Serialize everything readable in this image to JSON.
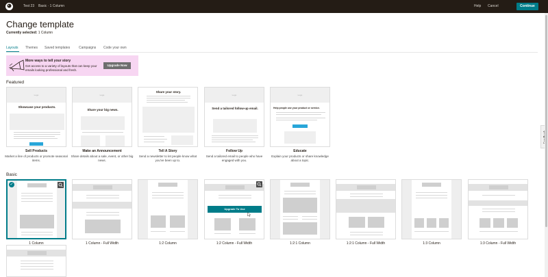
{
  "topbar": {
    "breadcrumb_campaign": "Test 23",
    "breadcrumb_section": "Basic · 1 Column",
    "help_label": "Help",
    "cancel_label": "Cancel",
    "continue_label": "Continue"
  },
  "page": {
    "title": "Change template",
    "current_label": "Currently selected:",
    "current_value": "1 Column"
  },
  "tabs": [
    "Layouts",
    "Themes",
    "Saved templates",
    "Campaigns",
    "Code your own"
  ],
  "promo": {
    "title": "More ways to tell your story",
    "body": "Get access to a variety of layouts that can keep your emails looking professional and fresh.",
    "button": "Upgrade Now"
  },
  "featured": {
    "label": "Featured",
    "items": [
      {
        "name": "Sell Products",
        "desc": "Market a line of products or promote seasonal items.",
        "headline": "Showcase your products."
      },
      {
        "name": "Make an Announcement",
        "desc": "Share details about a sale, event, or other big news.",
        "headline": "Share your big news."
      },
      {
        "name": "Tell A Story",
        "desc": "Send a newsletter to let people know what you've been up to.",
        "headline": "Share your story."
      },
      {
        "name": "Follow Up",
        "desc": "Send a tailored email to people who have engaged with you.",
        "headline": "Send a tailored follow-up email."
      },
      {
        "name": "Educate",
        "desc": "Explain your products or share knowledge about a topic.",
        "headline": "Help people use your product or service."
      }
    ],
    "logo_text": "Logo",
    "shop_button": "Shop Now",
    "signup_button": "Sign Up Now"
  },
  "basic": {
    "label": "Basic",
    "items": [
      "1 Column",
      "1 Column - Full Width",
      "1:2 Column",
      "1:2 Column - Full Width",
      "1:2:1 Column",
      "1:2:1 Column - Full Width",
      "1:3 Column",
      "1:3 Column - Full Width"
    ],
    "upgrade_overlay": "Upgrade To Use"
  },
  "feedback_label": "Feedback",
  "colors": {
    "topbar": "#241c15",
    "accent": "#007c89",
    "promo_bg": "#f7d6f2",
    "promo_button": "#6e6e6e"
  },
  "icons": {
    "logo": "mailchimp-freddie-icon",
    "promo_art": "megaphone-illustration",
    "selected": "check-icon",
    "preview": "magnifier-icon",
    "cursor": "pointer-cursor-icon"
  }
}
